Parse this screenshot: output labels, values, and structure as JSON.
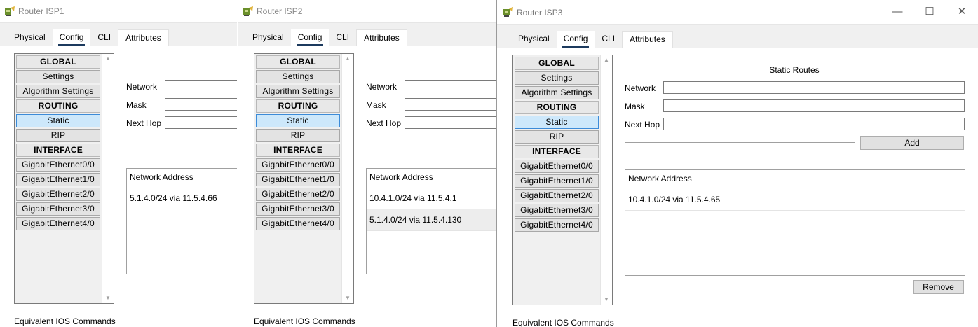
{
  "colors": {
    "tab_underline": "#1c3a5e",
    "selected_nav": "#cde8fb",
    "selected_nav_border": "#3c8bd8"
  },
  "icons": {
    "title": "router-icon"
  },
  "common": {
    "tabs": [
      "Physical",
      "Config",
      "CLI",
      "Attributes"
    ],
    "nav": {
      "global": "GLOBAL",
      "settings": "Settings",
      "algorithm_settings": "Algorithm Settings",
      "routing": "ROUTING",
      "static": "Static",
      "rip": "RIP",
      "interface": "INTERFACE",
      "interfaces": [
        "GigabitEthernet0/0",
        "GigabitEthernet1/0",
        "GigabitEthernet2/0",
        "GigabitEthernet3/0",
        "GigabitEthernet4/0"
      ]
    },
    "form": {
      "network": "Network",
      "mask": "Mask",
      "next_hop": "Next Hop"
    },
    "routes_header": "Network Address",
    "equivalent_ios": "Equivalent IOS Commands"
  },
  "windows": [
    {
      "title": "Router ISP1",
      "routes": [
        "5.1.4.0/24 via 11.5.4.66"
      ]
    },
    {
      "title": "Router ISP2",
      "routes": [
        "10.4.1.0/24 via 11.5.4.1",
        "5.1.4.0/24 via 11.5.4.130"
      ]
    },
    {
      "title": "Router ISP3",
      "section_title": "Static Routes",
      "add_button": "Add",
      "remove_button": "Remove",
      "routes": [
        "10.4.1.0/24 via 11.5.4.65"
      ],
      "controls": {
        "minimize": "—",
        "maximize": "☐",
        "close": "✕"
      }
    }
  ]
}
